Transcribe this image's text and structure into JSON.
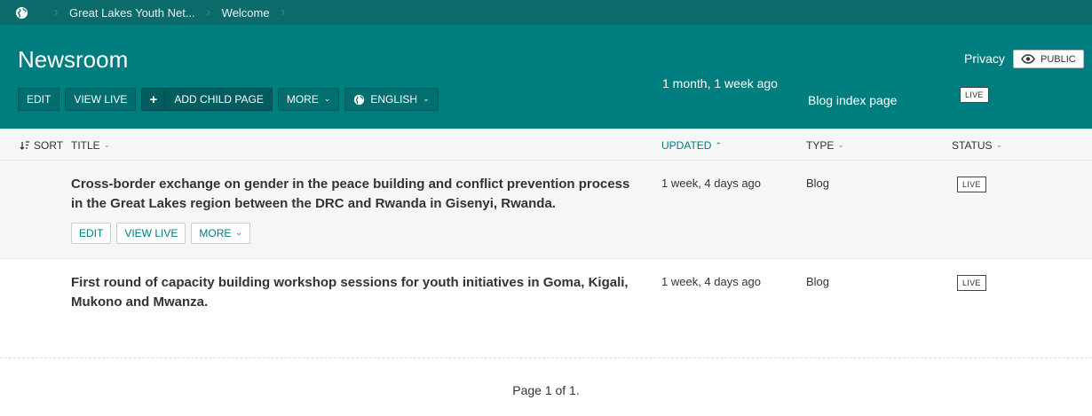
{
  "breadcrumb": {
    "home_icon": "globe-icon",
    "items": [
      "Great Lakes Youth Net...",
      "Welcome"
    ]
  },
  "header": {
    "title": "Newsroom",
    "buttons": {
      "edit": "EDIT",
      "view_live": "VIEW LIVE",
      "add_child": "ADD CHILD PAGE",
      "more": "MORE",
      "language": "ENGLISH"
    },
    "updated": "1 month, 1 week ago",
    "type": "Blog index page",
    "status": "LIVE",
    "privacy_label": "Privacy",
    "privacy_value": "PUBLIC"
  },
  "table": {
    "columns": {
      "sort": "SORT",
      "title": "TITLE",
      "updated": "UPDATED",
      "type": "TYPE",
      "status": "STATUS"
    },
    "rows": [
      {
        "title": "Cross-border exchange on gender in the peace building and conflict prevention process in the Great Lakes region between the DRC and Rwanda in Gisenyi, Rwanda.",
        "updated": "1 week, 4 days ago",
        "type": "Blog",
        "status": "LIVE",
        "actions": {
          "edit": "EDIT",
          "view_live": "VIEW LIVE",
          "more": "MORE"
        }
      },
      {
        "title": "First round of capacity building workshop sessions for youth initiatives in Goma, Kigali, Mukono and Mwanza.",
        "updated": "1 week, 4 days ago",
        "type": "Blog",
        "status": "LIVE"
      }
    ]
  },
  "pagination": "Page 1 of 1.",
  "colors": {
    "accent": "#007d7e",
    "breadcrumb_bg": "#0b6b6b",
    "row_alt_bg": "#f6f6f6"
  }
}
